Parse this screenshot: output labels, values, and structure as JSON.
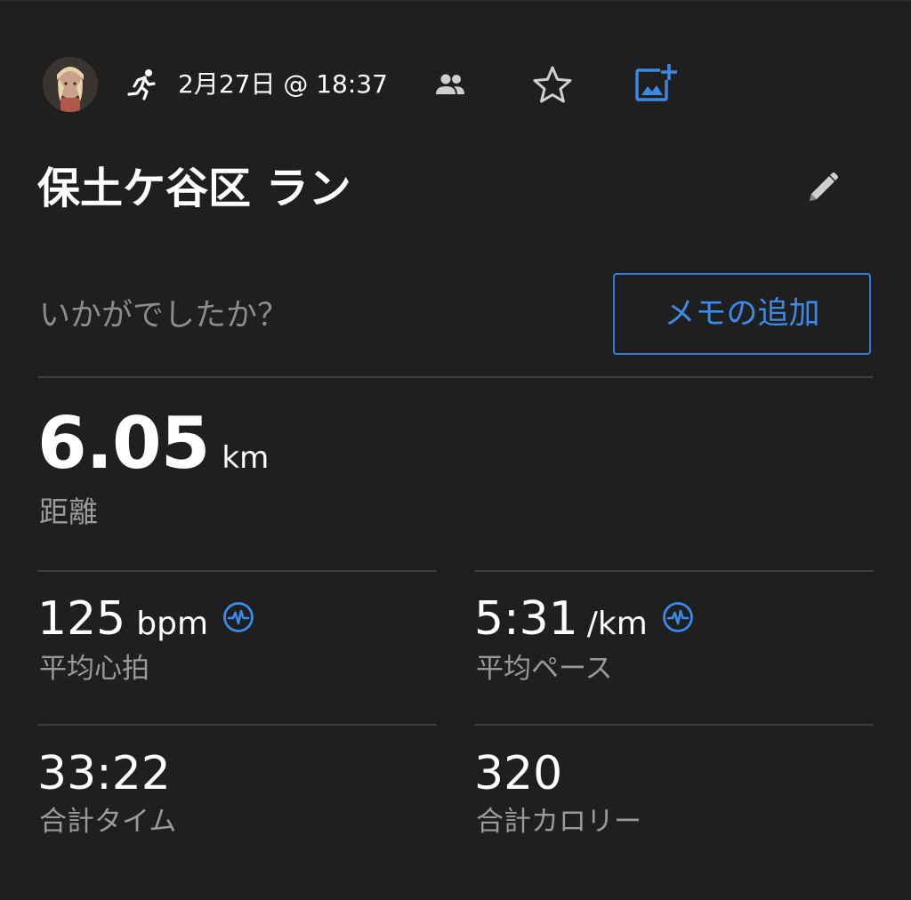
{
  "header": {
    "date_time": "2月27日 @ 18:37"
  },
  "activity": {
    "title": "保土ケ谷区 ラン"
  },
  "notes": {
    "prompt": "いかがでしたか？",
    "add_memo_label": "メモの追加"
  },
  "distance": {
    "value": "6.05",
    "unit": "km",
    "label": "距離"
  },
  "stats": [
    {
      "value": "125",
      "unit": "bpm",
      "label": "平均心拍"
    },
    {
      "value": "5:31",
      "unit": "/km",
      "label": "平均ペース"
    },
    {
      "value": "33:22",
      "unit": "",
      "label": "合計タイム"
    },
    {
      "value": "320",
      "unit": "",
      "label": "合計カロリー"
    }
  ],
  "colors": {
    "background": "#1f1f1f",
    "accent": "#3b8ae8",
    "secondary_text": "#9a9a9a",
    "divider": "#3c3c3c"
  },
  "icons": {
    "activity_type": "running-icon",
    "people": "people-icon",
    "favorite": "star-icon",
    "add_photo": "add-photo-icon",
    "edit": "pencil-icon",
    "heart_rate": "heart-rate-icon"
  }
}
